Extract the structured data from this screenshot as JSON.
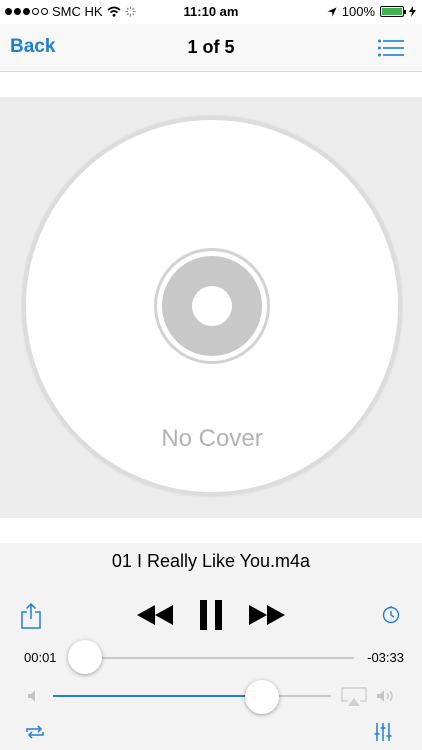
{
  "status_bar": {
    "carrier": "SMC HK",
    "time": "11:10 am",
    "battery": "100%",
    "signal_bars_filled": 3,
    "signal_bars_total": 5
  },
  "nav": {
    "back_label": "Back",
    "title": "1 of 5",
    "list_icon": "list-icon"
  },
  "artwork": {
    "placeholder_text": "No Cover"
  },
  "player": {
    "track_title": "01 I Really Like You.m4a",
    "elapsed": "00:01",
    "remaining": "-03:33",
    "progress_fraction": 0.005,
    "volume_fraction": 0.75
  },
  "icons": {
    "share": "share-icon",
    "rewind": "rewind-icon",
    "pause": "pause-icon",
    "forward": "fast-forward-icon",
    "timer": "sleep-timer-icon",
    "volume_low": "volume-low-icon",
    "volume_high": "volume-high-icon",
    "airplay": "airplay-icon",
    "repeat": "repeat-icon",
    "equalizer": "equalizer-icon"
  },
  "colors": {
    "accent": "#1f7fd8",
    "battery": "#3fb34f"
  }
}
